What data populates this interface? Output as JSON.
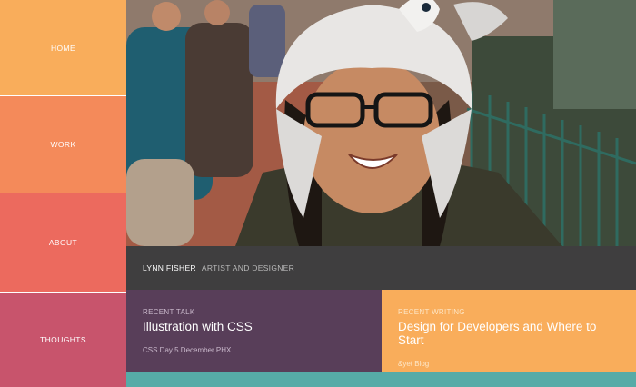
{
  "nav": {
    "items": [
      {
        "label": "HOME"
      },
      {
        "label": "WORK"
      },
      {
        "label": "ABOUT"
      },
      {
        "label": "THOUGHTS"
      }
    ]
  },
  "profile": {
    "name": "LYNN FISHER",
    "role": "ARTIST AND DESIGNER"
  },
  "talk": {
    "kicker": "RECENT TALK",
    "title": "Illustration with CSS",
    "meta": "CSS Day  5 December  PHX"
  },
  "writing": {
    "kicker": "RECENT WRITING",
    "title": "Design for Developers and Where to Start",
    "meta": "&yet Blog"
  },
  "colors": {
    "home": "#f9ad5b",
    "work": "#f48a5a",
    "about": "#ec6a5e",
    "thoughts": "#c8546c",
    "namebar": "#3f3e3f",
    "talk_card": "#583e59",
    "writing_card": "#f9ad5b",
    "strip": "#56aba7"
  }
}
